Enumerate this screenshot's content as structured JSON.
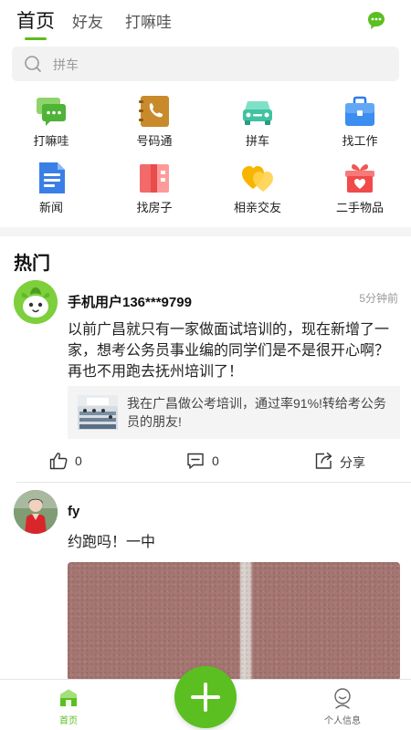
{
  "top_tabs": [
    {
      "label": "首页",
      "active": true
    },
    {
      "label": "好友",
      "active": false
    },
    {
      "label": "打嘛哇",
      "active": false
    }
  ],
  "accent_color": "#5bbf21",
  "search": {
    "placeholder": "拼车"
  },
  "grid": [
    {
      "label": "打嘛哇",
      "icon": "chat-bubbles-icon"
    },
    {
      "label": "号码通",
      "icon": "phone-book-icon"
    },
    {
      "label": "拼车",
      "icon": "car-icon"
    },
    {
      "label": "找工作",
      "icon": "briefcase-icon"
    },
    {
      "label": "新闻",
      "icon": "news-icon"
    },
    {
      "label": "找房子",
      "icon": "house-icon"
    },
    {
      "label": "相亲交友",
      "icon": "hearts-icon"
    },
    {
      "label": "二手物品",
      "icon": "gift-box-icon"
    }
  ],
  "section_title": "热门",
  "posts": [
    {
      "username": "手机用户136***9799",
      "time": "5分钟前",
      "text": "以前广昌就只有一家做面试培训的，现在新增了一家，想考公务员事业编的同学们是不是很开心啊？再也不用跑去抚州培训了！",
      "shared": {
        "text": "我在广昌做公考培训，通过率91%!转给考公务员的朋友!"
      },
      "likes": "0",
      "comments": "0",
      "share_label": "分享"
    },
    {
      "username": "fy",
      "text": "约跑吗！一中"
    }
  ],
  "bottom_nav": [
    {
      "label": "首页",
      "icon": "home-icon",
      "active": true
    },
    {
      "label": "个人信息",
      "icon": "profile-icon",
      "active": false
    }
  ]
}
